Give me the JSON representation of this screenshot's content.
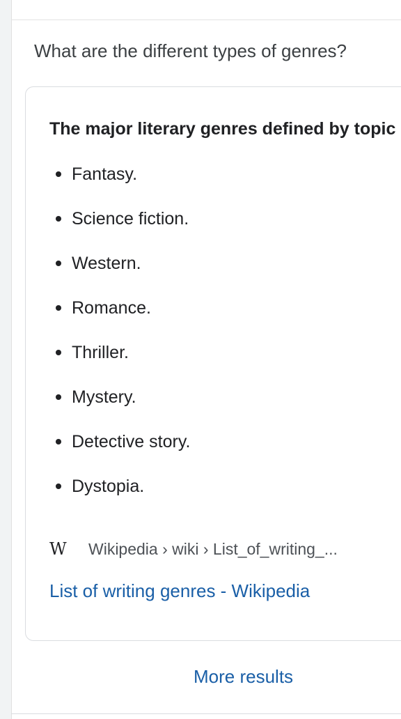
{
  "question": "What are the different types of genres?",
  "answer": {
    "heading": "The major literary genres defined by topic",
    "items": [
      {
        "label": "Fantasy."
      },
      {
        "label": "Science fiction."
      },
      {
        "label": "Western."
      },
      {
        "label": "Romance."
      },
      {
        "label": "Thriller."
      },
      {
        "label": "Mystery."
      },
      {
        "label": "Detective story."
      },
      {
        "label": "Dystopia."
      }
    ],
    "source": {
      "icon_glyph": "W",
      "icon": "wikipedia-icon",
      "breadcrumb": "Wikipedia › wiki › List_of_writing_...",
      "link_title": "List of writing genres - Wikipedia"
    }
  },
  "more_results_label": "More results",
  "colors": {
    "link": "#1a5fa7",
    "text": "#202124",
    "muted_text": "#4d5156",
    "border": "#dadce0"
  }
}
